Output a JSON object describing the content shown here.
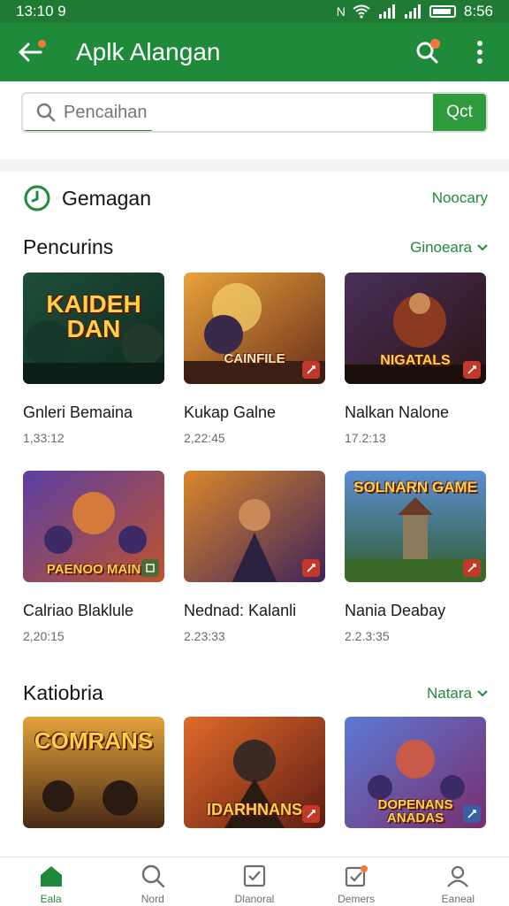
{
  "status_bar": {
    "time": "13:10 9",
    "clock_right": "8:56"
  },
  "app_bar": {
    "title": "Aplk Alangan"
  },
  "search": {
    "placeholder": "Pencaihan",
    "button_label": "Qct"
  },
  "section_header": {
    "title": "Gemagan",
    "link": "Noocary"
  },
  "sections": [
    {
      "title": "Pencurins",
      "link": "Ginoeara"
    },
    {
      "title": "Katiobria",
      "link": "Natara"
    }
  ],
  "games_row1": [
    {
      "name": "Gnleri Bemaina",
      "meta": "1,33:12",
      "art": "KAIDEH DAN"
    },
    {
      "name": "Kukap Galne",
      "meta": "2,22:45",
      "art": "CAINFILE"
    },
    {
      "name": "Nalkan Nalone",
      "meta": "17.2:13",
      "art": "NIGATALS"
    }
  ],
  "games_row2": [
    {
      "name": "Calriao Blaklule",
      "meta": "2,20:15",
      "art": "PAENOO MAIN"
    },
    {
      "name": "Nednad: Kalanli",
      "meta": "2.23:33",
      "art": ""
    },
    {
      "name": "Nania Deabay",
      "meta": "2.2.3:35",
      "art": "SOLNARN GAME"
    }
  ],
  "games_row3": [
    {
      "art": "COMRANS"
    },
    {
      "art": "IDARHNANS"
    },
    {
      "art": "DOPENANS ANADAS"
    }
  ],
  "bottom_nav": [
    {
      "label": "Eala",
      "icon": "home-icon",
      "active": true
    },
    {
      "label": "Nord",
      "icon": "search-icon",
      "active": false
    },
    {
      "label": "Dlanoral",
      "icon": "checklist-icon",
      "active": false
    },
    {
      "label": "Demers",
      "icon": "tasks-icon",
      "active": false
    },
    {
      "label": "Eaneal",
      "icon": "profile-icon",
      "active": false
    }
  ],
  "colors": {
    "brand": "#1f8a3a",
    "accent": "#f07a3a"
  }
}
